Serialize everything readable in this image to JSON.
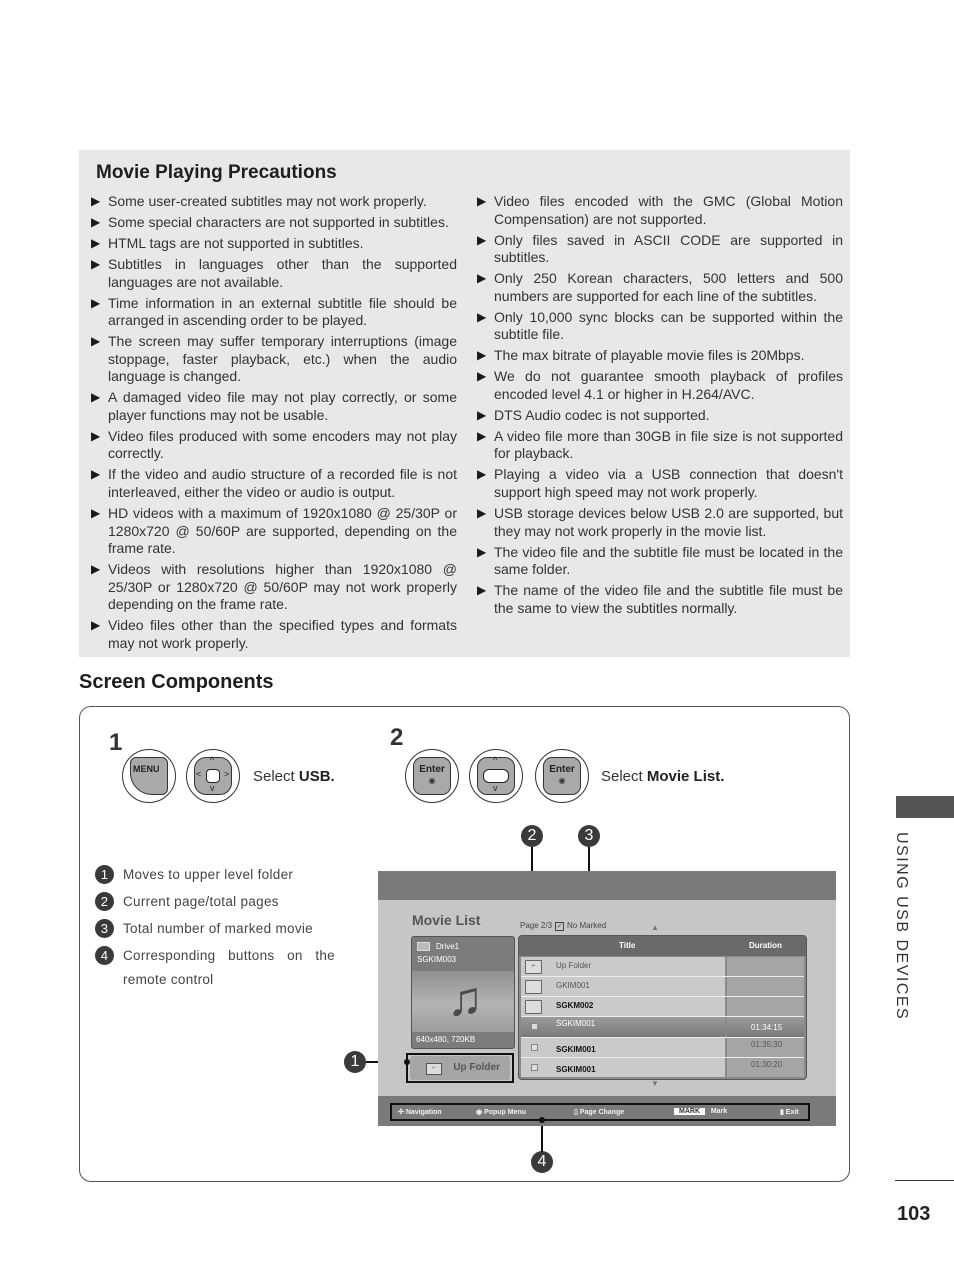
{
  "precautions": {
    "title": "Movie Playing Precautions",
    "bullet_glyph": "▶",
    "left_items": [
      "Some user-created subtitles may not work properly.",
      "Some special characters are not supported in subtitles.",
      "HTML tags are not supported in subtitles.",
      "Subtitles in languages other than the supported languages are not available.",
      "Time information in an external subtitle file should be arranged in ascending order to be played.",
      "The screen may suffer temporary interruptions (image stoppage, faster playback, etc.) when the audio language is changed.",
      "A damaged video file may not play correctly, or some player functions may not be usable.",
      "Video files produced with some encoders may not play correctly.",
      "If the video and audio structure of a recorded file is not interleaved, either the video or audio is output.",
      "HD videos with a maximum of 1920x1080 @ 25/30P or 1280x720 @ 50/60P are supported, depending on the frame rate.",
      "Videos with resolutions higher than 1920x1080 @ 25/30P or 1280x720 @ 50/60P may not work properly depending on the frame rate.",
      " Video files other than the specified types and formats may not work properly."
    ],
    "right_items": [
      "Video files encoded with the GMC (Global Motion Compensation) are not supported.",
      "Only files saved in ASCII CODE are supported in subtitles.",
      "Only 250 Korean characters, 500 letters and 500 numbers are supported for each line of the subtitles.",
      "Only 10,000 sync blocks can be supported within the subtitle file.",
      "The max bitrate of playable movie files is 20Mbps.",
      "We do not guarantee smooth playback of profiles encoded level 4.1 or higher in H.264/AVC.",
      "DTS Audio codec is not supported.",
      "A video file more than 30GB in file size is not supported for playback.",
      "Playing a video via a USB connection that doesn't support high speed may not work properly.",
      "USB storage devices below USB 2.0 are supported, but they may not work properly in the movie list.",
      "The video file and the subtitle file must be located in the same folder.",
      "The name of the video file and the subtitle file must be the same to view the subtitles normally."
    ]
  },
  "screen_components": {
    "title": "Screen Components",
    "step1": {
      "number": "1",
      "menu_key": "MENU",
      "select_prefix": "Select ",
      "select_target": "USB."
    },
    "step2": {
      "number": "2",
      "enter_key": "Enter",
      "enter_dot": "◉",
      "select_prefix": "Select ",
      "select_target": "Movie List."
    },
    "legend": [
      {
        "num": "1",
        "text": "Moves to upper level folder"
      },
      {
        "num": "2",
        "text": "Current page/total pages"
      },
      {
        "num": "3",
        "text": "Total number of marked movie"
      },
      {
        "num": "4",
        "text": "Corresponding buttons on the remote control"
      }
    ],
    "callouts": [
      "1",
      "2",
      "3",
      "4"
    ]
  },
  "tv_screen": {
    "title": "Movie List",
    "page_info": "Page 2/3",
    "marked_info": "No Marked",
    "check_glyph": "✓",
    "preview": {
      "drive": "Drive1",
      "file": "SGKIM003",
      "size": "640x480, 720KB",
      "note_glyph": "♫"
    },
    "up_folder_button": "Up Folder",
    "table": {
      "col_title": "Title",
      "col_duration": "Duration",
      "rows": [
        {
          "type": "upfolder",
          "name": "Up Folder",
          "duration": ""
        },
        {
          "type": "folder",
          "name": "GKIM001",
          "duration": ""
        },
        {
          "type": "folder",
          "name": "SGKM002",
          "duration": ""
        },
        {
          "type": "file",
          "name": "SGKIM001",
          "duration": "01:34:15",
          "selected": true
        },
        {
          "type": "file",
          "name": "SGKIM001",
          "duration": "01:35:30"
        },
        {
          "type": "file",
          "name": "SGKIM001",
          "duration": "01:30:20"
        }
      ]
    },
    "bottom_bar": {
      "navigation": "Navigation",
      "popup_menu": "Popup Menu",
      "page_change": "Page Change",
      "mark_key": "MARK",
      "mark": "Mark",
      "exit": "Exit"
    }
  },
  "side_tab": "USING USB DEVICES",
  "page_number": "103"
}
